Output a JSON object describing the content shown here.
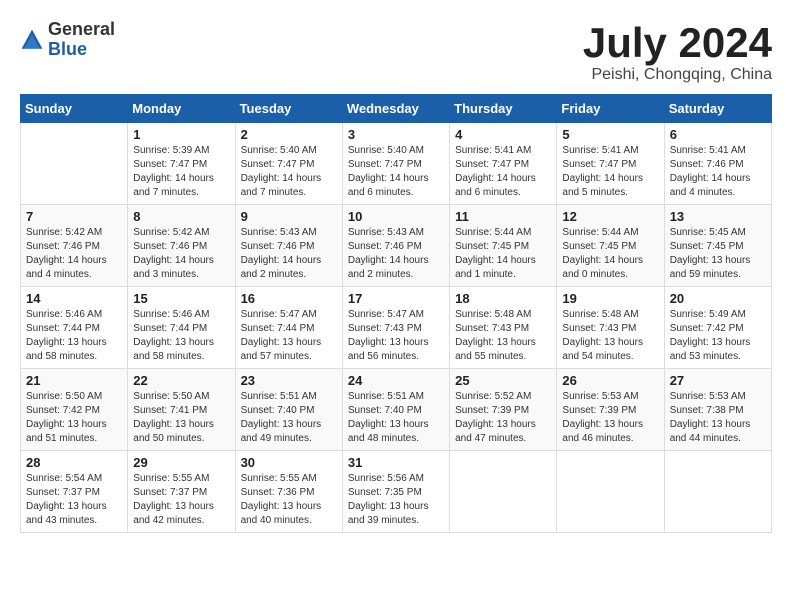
{
  "logo": {
    "general": "General",
    "blue": "Blue"
  },
  "title": "July 2024",
  "location": "Peishi, Chongqing, China",
  "headers": [
    "Sunday",
    "Monday",
    "Tuesday",
    "Wednesday",
    "Thursday",
    "Friday",
    "Saturday"
  ],
  "weeks": [
    [
      {
        "day": "",
        "info": ""
      },
      {
        "day": "1",
        "info": "Sunrise: 5:39 AM\nSunset: 7:47 PM\nDaylight: 14 hours\nand 7 minutes."
      },
      {
        "day": "2",
        "info": "Sunrise: 5:40 AM\nSunset: 7:47 PM\nDaylight: 14 hours\nand 7 minutes."
      },
      {
        "day": "3",
        "info": "Sunrise: 5:40 AM\nSunset: 7:47 PM\nDaylight: 14 hours\nand 6 minutes."
      },
      {
        "day": "4",
        "info": "Sunrise: 5:41 AM\nSunset: 7:47 PM\nDaylight: 14 hours\nand 6 minutes."
      },
      {
        "day": "5",
        "info": "Sunrise: 5:41 AM\nSunset: 7:47 PM\nDaylight: 14 hours\nand 5 minutes."
      },
      {
        "day": "6",
        "info": "Sunrise: 5:41 AM\nSunset: 7:46 PM\nDaylight: 14 hours\nand 4 minutes."
      }
    ],
    [
      {
        "day": "7",
        "info": "Sunrise: 5:42 AM\nSunset: 7:46 PM\nDaylight: 14 hours\nand 4 minutes."
      },
      {
        "day": "8",
        "info": "Sunrise: 5:42 AM\nSunset: 7:46 PM\nDaylight: 14 hours\nand 3 minutes."
      },
      {
        "day": "9",
        "info": "Sunrise: 5:43 AM\nSunset: 7:46 PM\nDaylight: 14 hours\nand 2 minutes."
      },
      {
        "day": "10",
        "info": "Sunrise: 5:43 AM\nSunset: 7:46 PM\nDaylight: 14 hours\nand 2 minutes."
      },
      {
        "day": "11",
        "info": "Sunrise: 5:44 AM\nSunset: 7:45 PM\nDaylight: 14 hours\nand 1 minute."
      },
      {
        "day": "12",
        "info": "Sunrise: 5:44 AM\nSunset: 7:45 PM\nDaylight: 14 hours\nand 0 minutes."
      },
      {
        "day": "13",
        "info": "Sunrise: 5:45 AM\nSunset: 7:45 PM\nDaylight: 13 hours\nand 59 minutes."
      }
    ],
    [
      {
        "day": "14",
        "info": "Sunrise: 5:46 AM\nSunset: 7:44 PM\nDaylight: 13 hours\nand 58 minutes."
      },
      {
        "day": "15",
        "info": "Sunrise: 5:46 AM\nSunset: 7:44 PM\nDaylight: 13 hours\nand 58 minutes."
      },
      {
        "day": "16",
        "info": "Sunrise: 5:47 AM\nSunset: 7:44 PM\nDaylight: 13 hours\nand 57 minutes."
      },
      {
        "day": "17",
        "info": "Sunrise: 5:47 AM\nSunset: 7:43 PM\nDaylight: 13 hours\nand 56 minutes."
      },
      {
        "day": "18",
        "info": "Sunrise: 5:48 AM\nSunset: 7:43 PM\nDaylight: 13 hours\nand 55 minutes."
      },
      {
        "day": "19",
        "info": "Sunrise: 5:48 AM\nSunset: 7:43 PM\nDaylight: 13 hours\nand 54 minutes."
      },
      {
        "day": "20",
        "info": "Sunrise: 5:49 AM\nSunset: 7:42 PM\nDaylight: 13 hours\nand 53 minutes."
      }
    ],
    [
      {
        "day": "21",
        "info": "Sunrise: 5:50 AM\nSunset: 7:42 PM\nDaylight: 13 hours\nand 51 minutes."
      },
      {
        "day": "22",
        "info": "Sunrise: 5:50 AM\nSunset: 7:41 PM\nDaylight: 13 hours\nand 50 minutes."
      },
      {
        "day": "23",
        "info": "Sunrise: 5:51 AM\nSunset: 7:40 PM\nDaylight: 13 hours\nand 49 minutes."
      },
      {
        "day": "24",
        "info": "Sunrise: 5:51 AM\nSunset: 7:40 PM\nDaylight: 13 hours\nand 48 minutes."
      },
      {
        "day": "25",
        "info": "Sunrise: 5:52 AM\nSunset: 7:39 PM\nDaylight: 13 hours\nand 47 minutes."
      },
      {
        "day": "26",
        "info": "Sunrise: 5:53 AM\nSunset: 7:39 PM\nDaylight: 13 hours\nand 46 minutes."
      },
      {
        "day": "27",
        "info": "Sunrise: 5:53 AM\nSunset: 7:38 PM\nDaylight: 13 hours\nand 44 minutes."
      }
    ],
    [
      {
        "day": "28",
        "info": "Sunrise: 5:54 AM\nSunset: 7:37 PM\nDaylight: 13 hours\nand 43 minutes."
      },
      {
        "day": "29",
        "info": "Sunrise: 5:55 AM\nSunset: 7:37 PM\nDaylight: 13 hours\nand 42 minutes."
      },
      {
        "day": "30",
        "info": "Sunrise: 5:55 AM\nSunset: 7:36 PM\nDaylight: 13 hours\nand 40 minutes."
      },
      {
        "day": "31",
        "info": "Sunrise: 5:56 AM\nSunset: 7:35 PM\nDaylight: 13 hours\nand 39 minutes."
      },
      {
        "day": "",
        "info": ""
      },
      {
        "day": "",
        "info": ""
      },
      {
        "day": "",
        "info": ""
      }
    ]
  ]
}
